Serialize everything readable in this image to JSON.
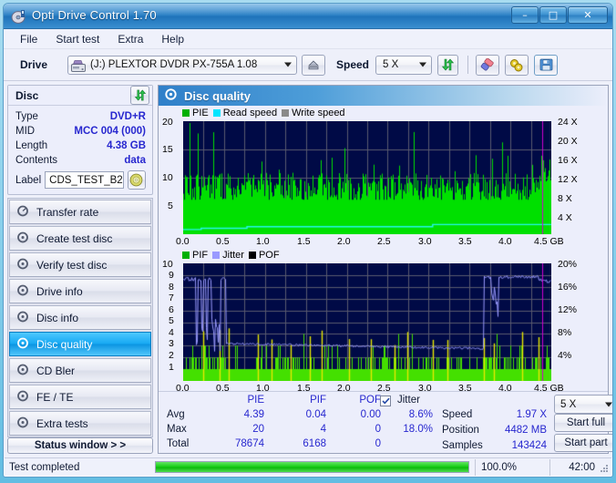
{
  "window": {
    "title": "Opti Drive Control 1.70",
    "icon": "disc-icon",
    "minimize": "–",
    "maximize": "□",
    "close": "✕"
  },
  "menu": {
    "items": [
      "File",
      "Start test",
      "Extra",
      "Help"
    ]
  },
  "toolbar": {
    "drive_label": "Drive",
    "drive_value": "(J:)  PLEXTOR DVDR   PX-755A 1.08",
    "eject_icon": "eject-icon",
    "speed_label": "Speed",
    "speed_value": "5 X",
    "refresh_icon": "refresh-icon",
    "erase_icon": "eraser-icon",
    "tools_icon": "tools-icon",
    "save_icon": "save-disk-icon"
  },
  "disc": {
    "header": "Disc",
    "refresh_icon": "refresh-icon",
    "rows": [
      {
        "key": "Type",
        "value": "DVD+R"
      },
      {
        "key": "MID",
        "value": "MCC 004 (000)"
      },
      {
        "key": "Length",
        "value": "4.38 GB"
      },
      {
        "key": "Contents",
        "value": "data"
      }
    ],
    "label_key": "Label",
    "label_value": "CDS_TEST_B2",
    "label_icon": "disc-media-icon"
  },
  "nav": {
    "items": [
      {
        "label": "Transfer rate",
        "icon": "speed-gauge-icon",
        "selected": false
      },
      {
        "label": "Create test disc",
        "icon": "burn-disc-icon",
        "selected": false
      },
      {
        "label": "Verify test disc",
        "icon": "verify-disc-icon",
        "selected": false
      },
      {
        "label": "Drive info",
        "icon": "drive-info-icon",
        "selected": false
      },
      {
        "label": "Disc info",
        "icon": "disc-info-icon",
        "selected": false
      },
      {
        "label": "Disc quality",
        "icon": "disc-quality-icon",
        "selected": true
      },
      {
        "label": "CD Bler",
        "icon": "cd-bler-icon",
        "selected": false
      },
      {
        "label": "FE / TE",
        "icon": "fe-te-icon",
        "selected": false
      },
      {
        "label": "Extra tests",
        "icon": "extra-tests-icon",
        "selected": false
      }
    ],
    "status_window": "Status window > >"
  },
  "panel": {
    "title": "Disc quality",
    "icon": "disc-quality-icon"
  },
  "stats": {
    "columns": [
      "PIE",
      "PIF",
      "POF",
      "Jitter"
    ],
    "jitter_checked": true,
    "rows": [
      {
        "label": "Avg",
        "pie": "4.39",
        "pif": "0.04",
        "pof": "0.00",
        "jitter": "8.6%"
      },
      {
        "label": "Max",
        "pie": "20",
        "pif": "4",
        "pof": "0",
        "jitter": "18.0%"
      },
      {
        "label": "Total",
        "pie": "78674",
        "pif": "6168",
        "pof": "0",
        "jitter": ""
      }
    ],
    "speed_label": "Speed",
    "speed_value": "1.97 X",
    "position_label": "Position",
    "position_value": "4482 MB",
    "samples_label": "Samples",
    "samples_value": "143424",
    "speed_select": "5 X",
    "start_full": "Start full",
    "start_part": "Start part"
  },
  "statusbar": {
    "message": "Test completed",
    "progress_percent": "100.0%",
    "progress_value": 100,
    "elapsed": "42:00"
  },
  "chart_data": [
    {
      "type": "area",
      "name": "pie-chart",
      "title": "PIE / Read speed / Write speed",
      "legend": [
        {
          "label": "PIE",
          "color": "#00c000"
        },
        {
          "label": "Read speed",
          "color": "#00e5ff"
        },
        {
          "label": "Write speed",
          "color": "#808080"
        }
      ],
      "legend_position": "top-left",
      "xlabel": "GB",
      "x_ticks": [
        "0.0",
        "0.5",
        "1.0",
        "1.5",
        "2.0",
        "2.5",
        "3.0",
        "3.5",
        "4.0",
        "4.5 GB"
      ],
      "xlim": [
        0,
        4.5
      ],
      "ylabel_left": "PIE",
      "y_ticks_left": [
        "20",
        "15",
        "10",
        "5"
      ],
      "ylim_left": [
        0,
        20
      ],
      "ylabel_right": "speed",
      "y_ticks_right": [
        "24 X",
        "20 X",
        "16 X",
        "12 X",
        "8 X",
        "4 X"
      ],
      "ylim_right": [
        0,
        24
      ],
      "grid": true,
      "plot_bg": "#000a46",
      "series": [
        {
          "name": "PIE",
          "color": "#00e000",
          "baseline_avg": 4.39,
          "max": 20,
          "fill": true
        },
        {
          "name": "Read speed",
          "color": "#26f5ee",
          "values_x_steps": [
            0.0,
            0.22,
            0.78,
            3.05
          ],
          "values_y": [
            1.0,
            1.25,
            1.6,
            2.0
          ]
        }
      ]
    },
    {
      "type": "area",
      "name": "pif-jitter-chart",
      "title": "PIF / Jitter / POF",
      "legend": [
        {
          "label": "PIF",
          "color": "#00c000"
        },
        {
          "label": "Jitter",
          "color": "#9a9aff"
        },
        {
          "label": "POF",
          "color": "#000000"
        }
      ],
      "legend_position": "top-left",
      "xlabel": "GB",
      "x_ticks": [
        "0.0",
        "0.5",
        "1.0",
        "1.5",
        "2.0",
        "2.5",
        "3.0",
        "3.5",
        "4.0",
        "4.5 GB"
      ],
      "xlim": [
        0,
        4.5
      ],
      "ylabel_left": "PIF",
      "y_ticks_left": [
        "10",
        "9",
        "8",
        "7",
        "6",
        "5",
        "4",
        "3",
        "2",
        "1"
      ],
      "ylim_left": [
        0,
        10
      ],
      "ylabel_right": "Jitter",
      "y_ticks_right": [
        "20%",
        "16%",
        "12%",
        "8%",
        "4%"
      ],
      "ylim_right": [
        0,
        20
      ],
      "grid": true,
      "plot_bg": "#000a46",
      "series": [
        {
          "name": "PIF",
          "color": "#44e000",
          "baseline_avg": 0.04,
          "max": 4,
          "fill": true
        },
        {
          "name": "Jitter",
          "color": "#9a9aff",
          "avg_percent": 8.6,
          "max_percent": 18.0
        },
        {
          "name": "POF",
          "color": "#000000",
          "total": 0
        }
      ]
    }
  ]
}
